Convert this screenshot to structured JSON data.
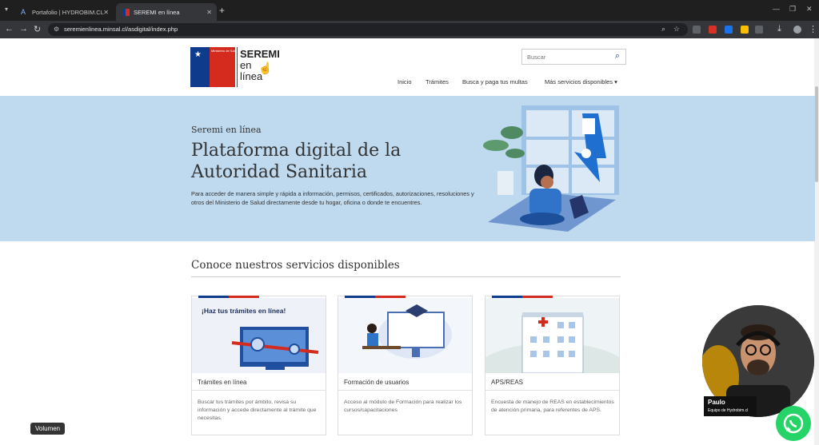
{
  "browser": {
    "tabs": [
      {
        "label": "Portafolio | HYDROBIM.CL",
        "active": false
      },
      {
        "label": "SEREMI en línea",
        "active": true
      }
    ],
    "new_tab": "+",
    "url": "seremienlinea.minsal.cl/asdigital/index.php"
  },
  "header": {
    "logo_text_line1": "SEREMI",
    "logo_text_line2": "en",
    "logo_text_line3": "línea",
    "logo_ministry": "Ministerio de Salud",
    "search_placeholder": "Buscar",
    "nav": [
      "Inicio",
      "Trámites",
      "Busca y paga tus multas",
      "Más servicios disponibles ▾"
    ]
  },
  "hero": {
    "kicker": "Seremi en línea",
    "title": "Plataforma digital de la Autoridad Sanitaria",
    "description": "Para acceder de manera simple y rápida a información, permisos, certificados, autorizaciones, resoluciones y otros del Ministerio de Salud directamente desde tu hogar, oficina o donde te encuentres."
  },
  "services": {
    "title": "Conoce nuestros servicios disponibles",
    "cards": [
      {
        "image_caption": "¡Haz tus trámites en línea!",
        "title": "Trámites en línea",
        "description": "Buscar tus trámites por ámbito, revisa su información y accede directamente al trámite que necesitas."
      },
      {
        "title": "Formación de usuarios",
        "description": "Acceso al módulo de Formación para realizar los cursos/capacitaciones"
      },
      {
        "title": "APS/REAS",
        "description": "Encuesta de manejo de REAS en establecimientos de atención primaria, para referentes de APS."
      }
    ]
  },
  "overlay": {
    "volume_label": "Volumen",
    "presenter_name": "Paulo",
    "presenter_team": "Equipo de Hydrobim.cl"
  },
  "colors": {
    "primary": "#0f3b8c",
    "accent": "#d52b1e",
    "hero_bg": "#bfd9ee",
    "whatsapp": "#25d366"
  }
}
